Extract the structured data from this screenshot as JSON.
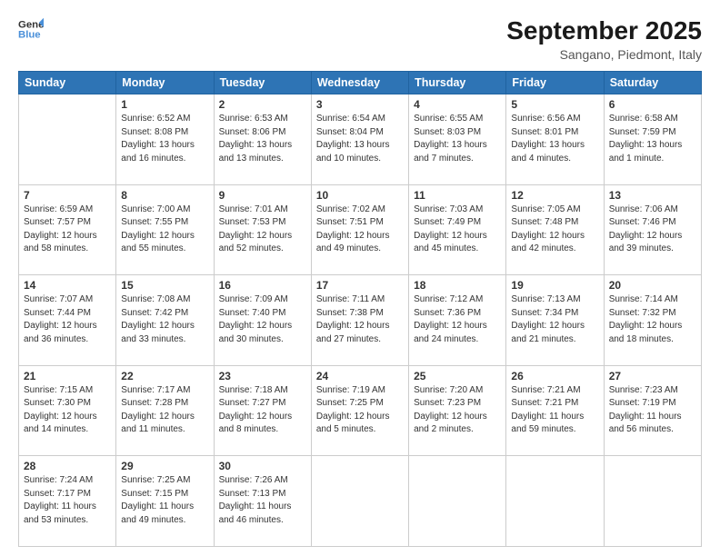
{
  "header": {
    "logo_line1": "General",
    "logo_line2": "Blue",
    "title": "September 2025",
    "subtitle": "Sangano, Piedmont, Italy"
  },
  "columns": [
    "Sunday",
    "Monday",
    "Tuesday",
    "Wednesday",
    "Thursday",
    "Friday",
    "Saturday"
  ],
  "weeks": [
    [
      {
        "day": "",
        "text": ""
      },
      {
        "day": "1",
        "text": "Sunrise: 6:52 AM\nSunset: 8:08 PM\nDaylight: 13 hours\nand 16 minutes."
      },
      {
        "day": "2",
        "text": "Sunrise: 6:53 AM\nSunset: 8:06 PM\nDaylight: 13 hours\nand 13 minutes."
      },
      {
        "day": "3",
        "text": "Sunrise: 6:54 AM\nSunset: 8:04 PM\nDaylight: 13 hours\nand 10 minutes."
      },
      {
        "day": "4",
        "text": "Sunrise: 6:55 AM\nSunset: 8:03 PM\nDaylight: 13 hours\nand 7 minutes."
      },
      {
        "day": "5",
        "text": "Sunrise: 6:56 AM\nSunset: 8:01 PM\nDaylight: 13 hours\nand 4 minutes."
      },
      {
        "day": "6",
        "text": "Sunrise: 6:58 AM\nSunset: 7:59 PM\nDaylight: 13 hours\nand 1 minute."
      }
    ],
    [
      {
        "day": "7",
        "text": "Sunrise: 6:59 AM\nSunset: 7:57 PM\nDaylight: 12 hours\nand 58 minutes."
      },
      {
        "day": "8",
        "text": "Sunrise: 7:00 AM\nSunset: 7:55 PM\nDaylight: 12 hours\nand 55 minutes."
      },
      {
        "day": "9",
        "text": "Sunrise: 7:01 AM\nSunset: 7:53 PM\nDaylight: 12 hours\nand 52 minutes."
      },
      {
        "day": "10",
        "text": "Sunrise: 7:02 AM\nSunset: 7:51 PM\nDaylight: 12 hours\nand 49 minutes."
      },
      {
        "day": "11",
        "text": "Sunrise: 7:03 AM\nSunset: 7:49 PM\nDaylight: 12 hours\nand 45 minutes."
      },
      {
        "day": "12",
        "text": "Sunrise: 7:05 AM\nSunset: 7:48 PM\nDaylight: 12 hours\nand 42 minutes."
      },
      {
        "day": "13",
        "text": "Sunrise: 7:06 AM\nSunset: 7:46 PM\nDaylight: 12 hours\nand 39 minutes."
      }
    ],
    [
      {
        "day": "14",
        "text": "Sunrise: 7:07 AM\nSunset: 7:44 PM\nDaylight: 12 hours\nand 36 minutes."
      },
      {
        "day": "15",
        "text": "Sunrise: 7:08 AM\nSunset: 7:42 PM\nDaylight: 12 hours\nand 33 minutes."
      },
      {
        "day": "16",
        "text": "Sunrise: 7:09 AM\nSunset: 7:40 PM\nDaylight: 12 hours\nand 30 minutes."
      },
      {
        "day": "17",
        "text": "Sunrise: 7:11 AM\nSunset: 7:38 PM\nDaylight: 12 hours\nand 27 minutes."
      },
      {
        "day": "18",
        "text": "Sunrise: 7:12 AM\nSunset: 7:36 PM\nDaylight: 12 hours\nand 24 minutes."
      },
      {
        "day": "19",
        "text": "Sunrise: 7:13 AM\nSunset: 7:34 PM\nDaylight: 12 hours\nand 21 minutes."
      },
      {
        "day": "20",
        "text": "Sunrise: 7:14 AM\nSunset: 7:32 PM\nDaylight: 12 hours\nand 18 minutes."
      }
    ],
    [
      {
        "day": "21",
        "text": "Sunrise: 7:15 AM\nSunset: 7:30 PM\nDaylight: 12 hours\nand 14 minutes."
      },
      {
        "day": "22",
        "text": "Sunrise: 7:17 AM\nSunset: 7:28 PM\nDaylight: 12 hours\nand 11 minutes."
      },
      {
        "day": "23",
        "text": "Sunrise: 7:18 AM\nSunset: 7:27 PM\nDaylight: 12 hours\nand 8 minutes."
      },
      {
        "day": "24",
        "text": "Sunrise: 7:19 AM\nSunset: 7:25 PM\nDaylight: 12 hours\nand 5 minutes."
      },
      {
        "day": "25",
        "text": "Sunrise: 7:20 AM\nSunset: 7:23 PM\nDaylight: 12 hours\nand 2 minutes."
      },
      {
        "day": "26",
        "text": "Sunrise: 7:21 AM\nSunset: 7:21 PM\nDaylight: 11 hours\nand 59 minutes."
      },
      {
        "day": "27",
        "text": "Sunrise: 7:23 AM\nSunset: 7:19 PM\nDaylight: 11 hours\nand 56 minutes."
      }
    ],
    [
      {
        "day": "28",
        "text": "Sunrise: 7:24 AM\nSunset: 7:17 PM\nDaylight: 11 hours\nand 53 minutes."
      },
      {
        "day": "29",
        "text": "Sunrise: 7:25 AM\nSunset: 7:15 PM\nDaylight: 11 hours\nand 49 minutes."
      },
      {
        "day": "30",
        "text": "Sunrise: 7:26 AM\nSunset: 7:13 PM\nDaylight: 11 hours\nand 46 minutes."
      },
      {
        "day": "",
        "text": ""
      },
      {
        "day": "",
        "text": ""
      },
      {
        "day": "",
        "text": ""
      },
      {
        "day": "",
        "text": ""
      }
    ]
  ]
}
